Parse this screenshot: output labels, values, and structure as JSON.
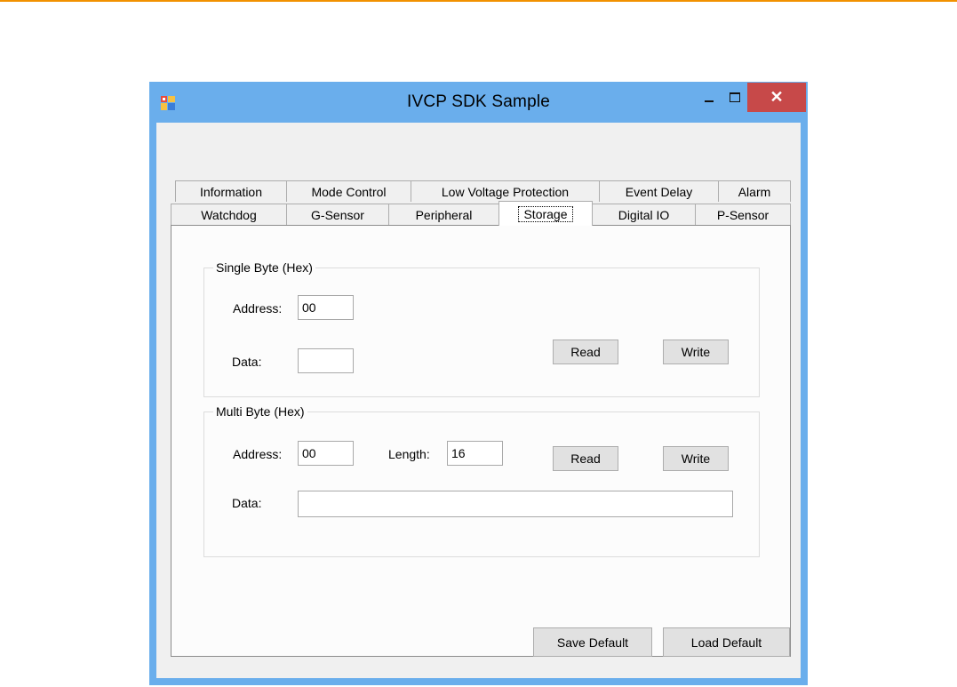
{
  "window": {
    "title": "IVCP SDK Sample",
    "minimize": "–",
    "maximize": "□",
    "close": "✕",
    "close_color": "#c74949"
  },
  "tabs_row1": [
    "Information",
    "Mode Control",
    "Low Voltage Protection",
    "Event Delay",
    "Alarm"
  ],
  "tabs_row2": [
    "Watchdog",
    "G-Sensor",
    "Peripheral",
    "Storage",
    "Digital IO",
    "P-Sensor"
  ],
  "selected_tab": "Storage",
  "single_byte": {
    "caption": "Single Byte (Hex)",
    "address_label": "Address:",
    "address_value": "00",
    "data_label": "Data:",
    "data_value": "",
    "read_label": "Read",
    "write_label": "Write"
  },
  "multi_byte": {
    "caption": "Multi Byte (Hex)",
    "address_label": "Address:",
    "address_value": "00",
    "length_label": "Length:",
    "length_value": "16",
    "data_label": "Data:",
    "data_value": "",
    "read_label": "Read",
    "write_label": "Write"
  },
  "footer": {
    "save_default": "Save Default",
    "load_default": "Load Default"
  },
  "colors": {
    "accent_rule": "#f29100",
    "window_frame": "#6aaeec"
  }
}
